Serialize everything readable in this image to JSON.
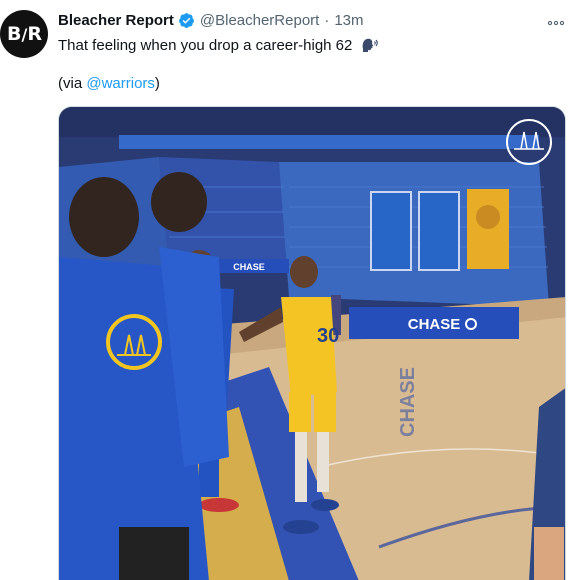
{
  "tweet": {
    "author_name": "Bleacher Report",
    "handle": "@BleacherReport",
    "separator": "·",
    "time": "13m",
    "text_main": "That feeling when you drop a career-high 62",
    "via_prefix": "(via ",
    "via_link": "@warriors",
    "via_suffix": ")",
    "avatar_text": "B/R",
    "avatar_left": "B",
    "avatar_right": "R",
    "emoji_icon": "speaking-head-icon"
  },
  "media": {
    "type": "video",
    "court_sign_text": "CHASE",
    "table_sign_text": "CHASE",
    "jersey_number": "30",
    "floor_text": "CHASE"
  },
  "colors": {
    "accent": "#1d9bf0",
    "secondary_text": "#536471",
    "avatar_bg": "#111111"
  }
}
